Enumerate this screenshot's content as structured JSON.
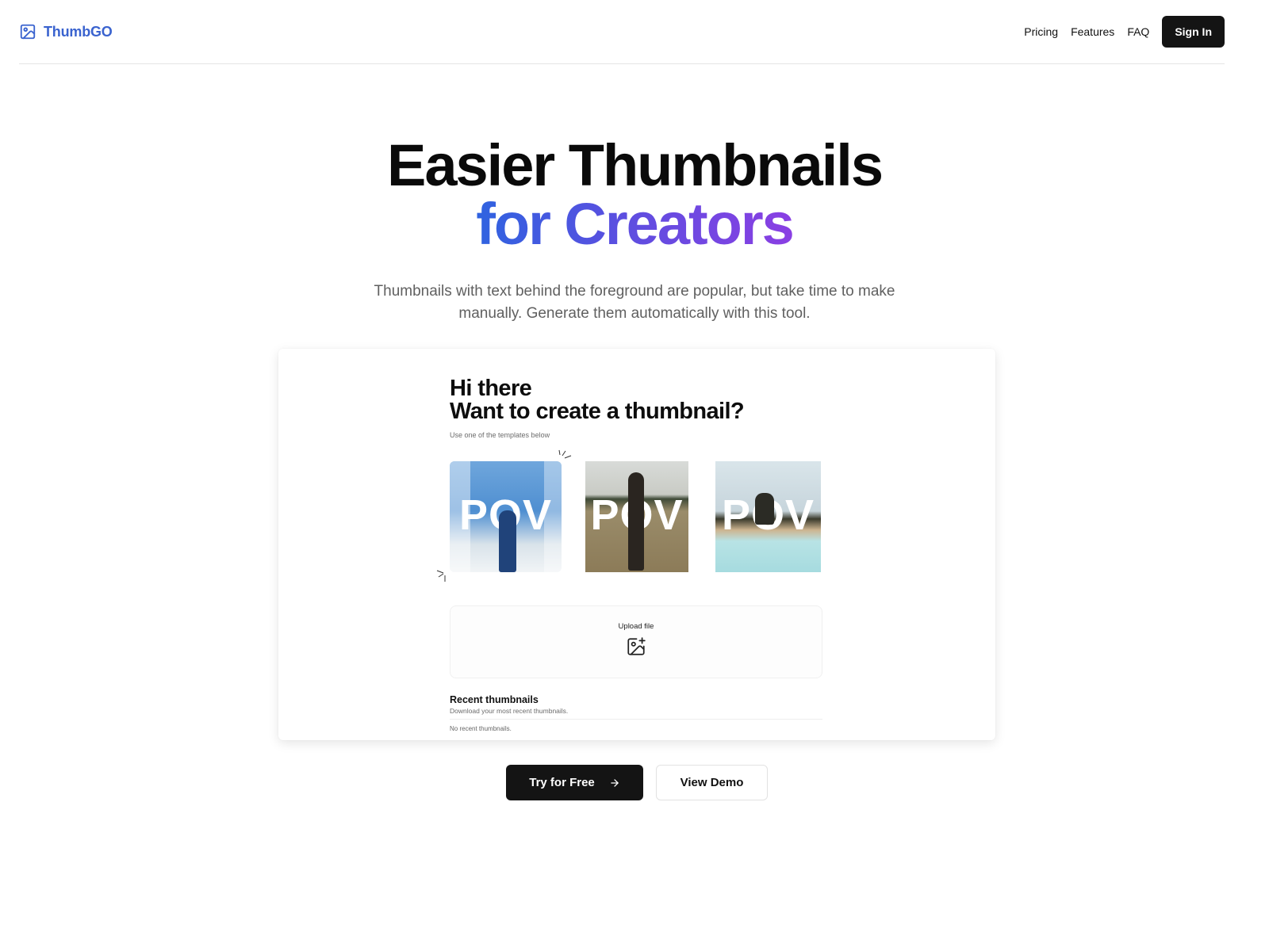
{
  "header": {
    "brand_name": "ThumbGO",
    "brand_icon": "image-icon",
    "nav": [
      {
        "label": "Pricing"
      },
      {
        "label": "Features"
      },
      {
        "label": "FAQ"
      }
    ],
    "sign_in_label": "Sign In"
  },
  "colors": {
    "brand": "#3a63cf",
    "gradient_start": "#2f63e0",
    "gradient_end": "#8a3fe3",
    "button_dark": "#141414"
  },
  "hero": {
    "title_line1": "Easier Thumbnails",
    "title_line2": "for Creators",
    "subtitle": "Thumbnails with text behind the foreground are popular, but take time to make manually. Generate them automatically with this tool."
  },
  "preview": {
    "greeting_line1": "Hi there",
    "greeting_line2": "Want to create a thumbnail?",
    "templates_hint": "Use one of the templates below",
    "templates": [
      {
        "text": "POV",
        "scene": "snowy mountain hiker"
      },
      {
        "text": "POV",
        "scene": "field with trees"
      },
      {
        "text": "POV",
        "scene": "poolside"
      }
    ],
    "upload_label": "Upload file",
    "upload_icon": "image-plus-icon",
    "recent_title": "Recent thumbnails",
    "recent_subtitle": "Download your most recent thumbnails.",
    "recent_empty": "No recent thumbnails."
  },
  "cta": {
    "primary_label": "Try for Free",
    "primary_icon": "arrow-right-icon",
    "secondary_label": "View Demo"
  }
}
